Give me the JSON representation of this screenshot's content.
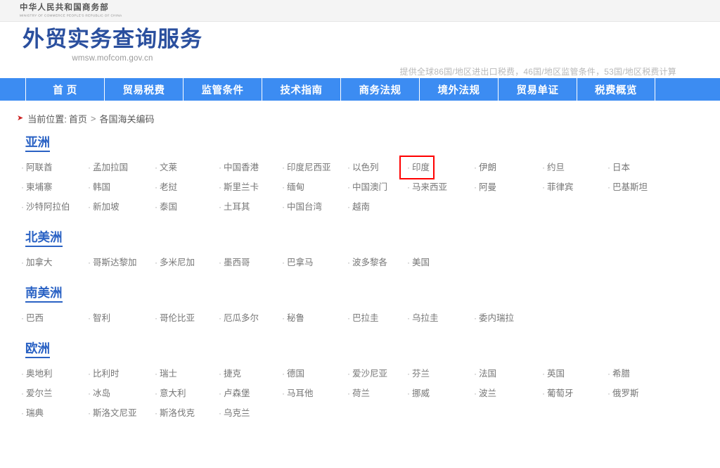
{
  "gov_bar": {
    "name_cn": "中华人民共和国商务部",
    "name_en": "MINISTRY OF COMMERCE PEOPLE'S REPUBLIC OF CHINA"
  },
  "header": {
    "title": "外贸实务查询服务",
    "url": "wmsw.mofcom.gov.cn",
    "tagline": "提供全球86国/地区进出口税费，46国/地区监管条件，53国/地区税费计算",
    "title_color": "#2a4f9e"
  },
  "nav": {
    "background_color": "#3c8cf2",
    "items": [
      {
        "label": "首 页"
      },
      {
        "label": "贸易税费"
      },
      {
        "label": "监管条件"
      },
      {
        "label": "技术指南"
      },
      {
        "label": "商务法规"
      },
      {
        "label": "境外法规"
      },
      {
        "label": "贸易单证"
      },
      {
        "label": "税费概览"
      }
    ]
  },
  "breadcrumb": {
    "arrow_icon": "chevron-right-icon",
    "arrow_color": "#cc2222",
    "label": "当前位置:",
    "home": "首页",
    "separator": ">",
    "current": "各国海关编码"
  },
  "highlight": {
    "country": "印度",
    "color": "#ff0000"
  },
  "regions": [
    {
      "title": "亚洲",
      "rows": [
        [
          "阿联酋",
          "孟加拉国",
          "文莱",
          "中国香港",
          "印度尼西亚",
          "以色列",
          "印度",
          "伊朗",
          "约旦",
          "日本"
        ],
        [
          "柬埔寨",
          "韩国",
          "老挝",
          "斯里兰卡",
          "缅甸",
          "中国澳门",
          "马来西亚",
          "阿曼",
          "菲律宾",
          "巴基斯坦"
        ],
        [
          "沙特阿拉伯",
          "新加坡",
          "泰国",
          "土耳其",
          "中国台湾",
          "越南"
        ]
      ]
    },
    {
      "title": "北美洲",
      "rows": [
        [
          "加拿大",
          "哥斯达黎加",
          "多米尼加",
          "墨西哥",
          "巴拿马",
          "波多黎各",
          "美国"
        ]
      ]
    },
    {
      "title": "南美洲",
      "rows": [
        [
          "巴西",
          "智利",
          "哥伦比亚",
          "厄瓜多尔",
          "秘鲁",
          "巴拉圭",
          "乌拉圭",
          "委内瑞拉"
        ]
      ]
    },
    {
      "title": "欧洲",
      "rows": [
        [
          "奥地利",
          "比利时",
          "瑞士",
          "捷克",
          "德国",
          "爱沙尼亚",
          "芬兰",
          "法国",
          "英国",
          "希腊"
        ],
        [
          "爱尔兰",
          "冰岛",
          "意大利",
          "卢森堡",
          "马耳他",
          "荷兰",
          "挪威",
          "波兰",
          "葡萄牙",
          "俄罗斯"
        ],
        [
          "瑞典",
          "斯洛文尼亚",
          "斯洛伐克",
          "乌克兰"
        ]
      ]
    }
  ]
}
